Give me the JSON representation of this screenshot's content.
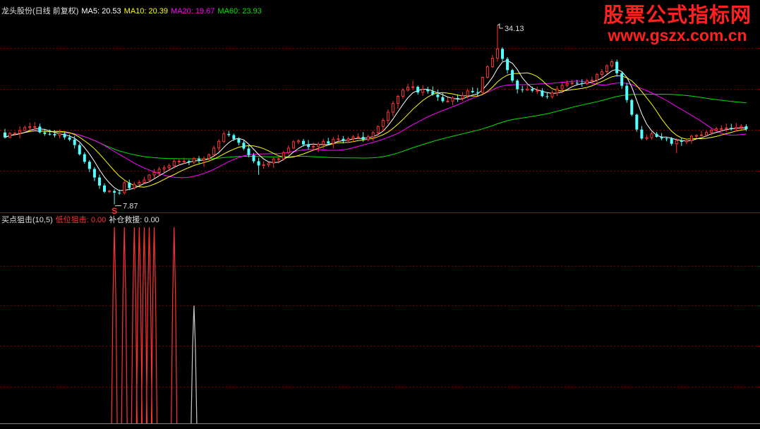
{
  "header": {
    "symbol": "龙头股份(日线 前复权)",
    "ma5": "MA5: 20.53",
    "ma10": "MA10: 20.39",
    "ma20": "MA20: 19.67",
    "ma60": "MA60: 23.93"
  },
  "indicator": {
    "name": "买点狙击(10,5)",
    "low_snipe": "低位狙击: 0.00",
    "refill": "补仓救援: 0.00"
  },
  "watermark": {
    "title": "股票公式指标网",
    "url": "www.gszx.com.cn"
  },
  "colors": {
    "background": "#000000",
    "up_candle": "#ff3232",
    "down_candle": "#54ffff",
    "ma5": "#ffffff",
    "ma10": "#ffff00",
    "ma20": "#ff00ff",
    "ma60": "#00e000",
    "grid": "#8b0000",
    "low_snipe": "#ff3232",
    "refill": "#c8c8c8",
    "separator": "#b40000"
  },
  "chart_data": [
    {
      "type": "candlestick",
      "ylim": [
        7.0,
        36.0
      ],
      "annotations": [
        {
          "text": "34.13",
          "bar": 99,
          "value": 34.13
        },
        {
          "text": "7.87",
          "bar": 22,
          "value": 7.87
        },
        {
          "text": "S",
          "bar": 22,
          "kind": "sell-marker"
        }
      ],
      "candles": [
        [
          18.42,
          18.95,
          17.51,
          17.69
        ],
        [
          17.69,
          18.47,
          17.62,
          18.29
        ],
        [
          18.29,
          18.52,
          17.95,
          18.3
        ],
        [
          18.3,
          19.32,
          17.57,
          18.68
        ],
        [
          18.68,
          19.43,
          18.67,
          19.14
        ],
        [
          19.14,
          19.87,
          18.83,
          19.26
        ],
        [
          19.26,
          19.93,
          18.77,
          19.27
        ],
        [
          19.27,
          19.72,
          18.29,
          18.43
        ],
        [
          18.43,
          18.96,
          17.93,
          18.21
        ],
        [
          18.21,
          18.86,
          17.97,
          18.2
        ],
        [
          18.2,
          18.77,
          17.7,
          17.99
        ],
        [
          17.99,
          18.87,
          17.54,
          18.24
        ],
        [
          18.24,
          18.49,
          17.38,
          17.7
        ],
        [
          17.7,
          18.12,
          17.12,
          17.37
        ],
        [
          17.37,
          17.92,
          16.07,
          16.57
        ],
        [
          16.57,
          16.83,
          15.04,
          15.22
        ],
        [
          15.22,
          15.51,
          13.83,
          14.12
        ],
        [
          14.12,
          14.37,
          12.61,
          13.07
        ],
        [
          13.07,
          13.36,
          11.28,
          11.81
        ],
        [
          11.81,
          12.23,
          10.15,
          10.63
        ],
        [
          10.63,
          10.96,
          9.51,
          9.72
        ],
        [
          9.72,
          10.0,
          9.54,
          9.82
        ],
        [
          9.82,
          10.1,
          7.87,
          9.58
        ],
        [
          9.58,
          10.04,
          9.26,
          9.57
        ],
        [
          9.57,
          11.34,
          9.3,
          11.04
        ],
        [
          11.04,
          11.5,
          9.96,
          10.27
        ],
        [
          10.27,
          11.15,
          10.05,
          10.82
        ],
        [
          10.82,
          11.41,
          10.61,
          11.09
        ],
        [
          11.09,
          11.91,
          10.93,
          11.45
        ],
        [
          11.45,
          12.32,
          11.08,
          12.18
        ],
        [
          12.18,
          13.04,
          11.75,
          12.54
        ],
        [
          12.54,
          13.38,
          11.98,
          13.03
        ],
        [
          13.03,
          13.6,
          12.58,
          13.23
        ],
        [
          13.23,
          13.86,
          12.93,
          13.54
        ],
        [
          13.54,
          14.5,
          13.11,
          14.19
        ],
        [
          14.19,
          14.61,
          13.56,
          14.21
        ],
        [
          14.21,
          14.72,
          13.76,
          14.22
        ],
        [
          14.22,
          14.4,
          13.63,
          14.06
        ],
        [
          14.06,
          14.81,
          13.76,
          14.59
        ],
        [
          14.59,
          14.96,
          13.89,
          14.37
        ],
        [
          14.37,
          14.91,
          13.38,
          14.59
        ],
        [
          14.59,
          15.36,
          14.31,
          15.16
        ],
        [
          15.16,
          16.49,
          14.76,
          16.13
        ],
        [
          16.13,
          17.43,
          15.64,
          17.12
        ],
        [
          17.12,
          18.63,
          16.89,
          18.21
        ],
        [
          18.21,
          18.66,
          17.78,
          18.03
        ],
        [
          18.03,
          18.26,
          17.16,
          17.48
        ],
        [
          17.48,
          17.72,
          16.54,
          16.91
        ],
        [
          16.91,
          17.27,
          15.84,
          16.06
        ],
        [
          16.06,
          16.58,
          14.77,
          15.11
        ],
        [
          15.11,
          15.42,
          13.91,
          14.2
        ],
        [
          14.2,
          14.71,
          12.23,
          13.58
        ],
        [
          13.58,
          14.18,
          13.09,
          13.69
        ],
        [
          13.69,
          14.1,
          13.31,
          13.93
        ],
        [
          13.93,
          14.78,
          13.21,
          14.53
        ],
        [
          14.53,
          15.07,
          13.87,
          14.56
        ],
        [
          14.56,
          15.72,
          14.29,
          15.46
        ],
        [
          15.46,
          16.52,
          15.18,
          16.13
        ],
        [
          16.13,
          17.3,
          16.0,
          17.05
        ],
        [
          17.05,
          17.45,
          16.71,
          17.19
        ],
        [
          17.19,
          17.47,
          16.36,
          16.67
        ],
        [
          16.67,
          17.31,
          15.9,
          16.29
        ],
        [
          16.29,
          16.92,
          15.69,
          16.4
        ],
        [
          16.4,
          17.01,
          15.52,
          16.7
        ],
        [
          16.7,
          17.5,
          16.06,
          17.12
        ],
        [
          17.12,
          17.63,
          16.56,
          16.81
        ],
        [
          16.81,
          17.76,
          16.09,
          17.41
        ],
        [
          17.41,
          18.05,
          17.12,
          17.49
        ],
        [
          17.49,
          17.89,
          16.81,
          17.27
        ],
        [
          17.27,
          17.78,
          16.88,
          17.5
        ],
        [
          17.5,
          18.04,
          17.02,
          17.76
        ],
        [
          17.76,
          18.27,
          17.47,
          17.76
        ],
        [
          17.76,
          18.47,
          17.06,
          17.38
        ],
        [
          17.38,
          18.07,
          17.12,
          17.8
        ],
        [
          17.8,
          18.65,
          17.21,
          18.39
        ],
        [
          18.39,
          19.47,
          17.73,
          19.3
        ],
        [
          19.3,
          20.54,
          18.6,
          20.2
        ],
        [
          20.2,
          21.79,
          19.67,
          21.4
        ],
        [
          21.4,
          23.05,
          20.79,
          22.68
        ],
        [
          22.68,
          23.95,
          21.91,
          23.73
        ],
        [
          23.73,
          24.93,
          23.38,
          24.64
        ],
        [
          24.64,
          25.57,
          24.45,
          25.08
        ],
        [
          25.08,
          26.01,
          24.65,
          25.12
        ],
        [
          25.12,
          25.34,
          23.98,
          24.3
        ],
        [
          24.3,
          25.34,
          23.8,
          24.72
        ],
        [
          24.72,
          25.12,
          24.11,
          24.47
        ],
        [
          24.47,
          25.19,
          23.81,
          23.99
        ],
        [
          23.99,
          24.69,
          23.07,
          23.61
        ],
        [
          23.61,
          24.18,
          22.79,
          23.01
        ],
        [
          23.01,
          23.56,
          22.82,
          23.03
        ],
        [
          23.03,
          23.77,
          22.41,
          23.47
        ],
        [
          23.47,
          24.01,
          22.9,
          23.43
        ],
        [
          23.43,
          24.36,
          23.05,
          23.83
        ],
        [
          23.83,
          24.84,
          23.42,
          24.52
        ],
        [
          24.52,
          25.05,
          24.17,
          24.33
        ],
        [
          24.33,
          24.95,
          23.71,
          24.26
        ],
        [
          24.26,
          26.52,
          24.11,
          26.52
        ],
        [
          26.52,
          28.28,
          26.36,
          28.07
        ],
        [
          28.07,
          29.79,
          27.91,
          29.32
        ],
        [
          29.32,
          34.13,
          28.86,
          30.69
        ],
        [
          30.69,
          30.94,
          28.87,
          29.22
        ],
        [
          29.22,
          29.48,
          27.07,
          27.58
        ],
        [
          27.58,
          27.77,
          25.73,
          26.04
        ],
        [
          26.04,
          26.25,
          24.15,
          24.76
        ],
        [
          24.76,
          25.29,
          24.29,
          24.65
        ],
        [
          24.65,
          25.35,
          24.5,
          24.8
        ],
        [
          24.8,
          25.16,
          24.32,
          24.55
        ],
        [
          24.55,
          25.1,
          24.07,
          24.58
        ],
        [
          24.58,
          24.93,
          23.58,
          23.75
        ],
        [
          23.75,
          24.36,
          23.35,
          23.66
        ],
        [
          23.66,
          24.58,
          23.41,
          24.23
        ],
        [
          24.23,
          25.23,
          23.76,
          24.81
        ],
        [
          24.81,
          25.83,
          24.18,
          25.33
        ],
        [
          25.33,
          26.05,
          25.06,
          25.62
        ],
        [
          25.62,
          26.16,
          25.3,
          25.71
        ],
        [
          25.71,
          26.12,
          25.32,
          25.66
        ],
        [
          25.66,
          26.24,
          25.12,
          25.59
        ],
        [
          25.59,
          26.32,
          25.35,
          25.99
        ],
        [
          25.99,
          26.61,
          25.57,
          26.11
        ],
        [
          26.11,
          27.16,
          25.67,
          26.94
        ],
        [
          26.94,
          27.71,
          26.42,
          27.34
        ],
        [
          27.34,
          28.46,
          27.0,
          28.2
        ],
        [
          28.2,
          29.14,
          27.89,
          28.8
        ],
        [
          28.8,
          29.11,
          26.61,
          27.13
        ],
        [
          27.13,
          27.4,
          24.84,
          25.27
        ],
        [
          25.27,
          25.71,
          22.8,
          23.18
        ],
        [
          23.18,
          23.35,
          20.81,
          21.03
        ],
        [
          21.03,
          21.19,
          18.52,
          18.85
        ],
        [
          18.85,
          19.36,
          17.32,
          17.53
        ],
        [
          17.53,
          18.11,
          17.27,
          17.66
        ],
        [
          17.66,
          18.52,
          17.4,
          18.22
        ],
        [
          18.22,
          18.48,
          17.67,
          17.78
        ],
        [
          17.78,
          18.33,
          17.28,
          17.54
        ],
        [
          17.54,
          17.75,
          17.13,
          17.53
        ],
        [
          17.53,
          17.76,
          16.49,
          16.76
        ],
        [
          16.76,
          17.58,
          15.39,
          17.24
        ],
        [
          17.24,
          17.61,
          16.45,
          17.05
        ],
        [
          17.05,
          17.37,
          16.69,
          17.2
        ],
        [
          17.2,
          18.1,
          16.76,
          17.87
        ],
        [
          17.87,
          18.15,
          17.54,
          17.99
        ],
        [
          17.99,
          18.63,
          17.85,
          18.06
        ],
        [
          18.06,
          18.69,
          17.78,
          18.43
        ],
        [
          18.43,
          18.98,
          17.99,
          18.74
        ],
        [
          18.74,
          19.25,
          18.59,
          18.97
        ],
        [
          18.97,
          19.48,
          18.56,
          18.99
        ],
        [
          18.99,
          19.73,
          18.45,
          19.09
        ],
        [
          19.09,
          19.7,
          18.71,
          18.96
        ],
        [
          18.96,
          19.8,
          18.59,
          19.16
        ],
        [
          19.16,
          19.65,
          18.86,
          19.33
        ],
        [
          19.33,
          19.62,
          18.63,
          18.89
        ]
      ]
    },
    {
      "type": "bar",
      "ylim": [
        0,
        1
      ],
      "series": [
        {
          "name": "低位狙击",
          "bars": [
            [
              22,
              1
            ],
            [
              24,
              1
            ],
            [
              26,
              1
            ],
            [
              27,
              1
            ],
            [
              28,
              1
            ],
            [
              29,
              1
            ],
            [
              30,
              1
            ],
            [
              34,
              1
            ]
          ]
        },
        {
          "name": "补仓救援",
          "bars": [
            [
              38,
              0.6
            ]
          ]
        }
      ]
    }
  ]
}
